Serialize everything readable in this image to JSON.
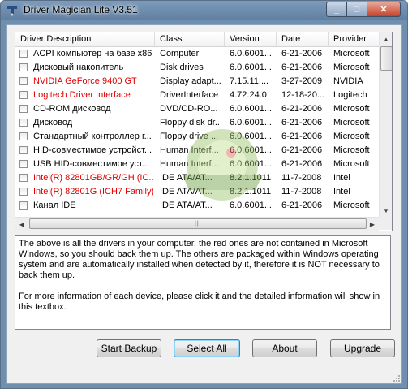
{
  "window": {
    "title": "Driver Magician Lite V3.51",
    "controls": {
      "minimize": "_",
      "maximize": "□",
      "close": "✕"
    }
  },
  "table": {
    "columns": [
      "Driver Description",
      "Class",
      "Version",
      "Date",
      "Provider"
    ],
    "rows": [
      {
        "description": "ACPI компьютер на базе x86",
        "class": "Computer",
        "version": "6.0.6001...",
        "date": "6-21-2006",
        "provider": "Microsoft",
        "red": false
      },
      {
        "description": "Дисковый накопитель",
        "class": "Disk drives",
        "version": "6.0.6001...",
        "date": "6-21-2006",
        "provider": "Microsoft",
        "red": false
      },
      {
        "description": "NVIDIA GeForce 9400 GT",
        "class": "Display adapt...",
        "version": "7.15.11....",
        "date": "3-27-2009",
        "provider": "NVIDIA",
        "red": true
      },
      {
        "description": "Logitech Driver Interface",
        "class": "DriverInterface",
        "version": "4.72.24.0",
        "date": "12-18-20...",
        "provider": "Logitech",
        "red": true
      },
      {
        "description": "CD-ROM дисковод",
        "class": "DVD/CD-RO...",
        "version": "6.0.6001...",
        "date": "6-21-2006",
        "provider": "Microsoft",
        "red": false
      },
      {
        "description": "Дисковод",
        "class": "Floppy disk dr...",
        "version": "6.0.6001...",
        "date": "6-21-2006",
        "provider": "Microsoft",
        "red": false
      },
      {
        "description": "Стандартный контроллер г...",
        "class": "Floppy drive ...",
        "version": "6.0.6001...",
        "date": "6-21-2006",
        "provider": "Microsoft",
        "red": false
      },
      {
        "description": "HID-совместимое устройст...",
        "class": "Human Interf...",
        "version": "6.0.6001...",
        "date": "6-21-2006",
        "provider": "Microsoft",
        "red": false
      },
      {
        "description": "USB HID-совместимое уст...",
        "class": "Human Interf...",
        "version": "6.0.6001...",
        "date": "6-21-2006",
        "provider": "Microsoft",
        "red": false
      },
      {
        "description": "Intel(R) 82801GB/GR/GH (IC...",
        "class": "IDE ATA/AT...",
        "version": "8.2.1.1011",
        "date": "11-7-2008",
        "provider": "Intel",
        "red": true
      },
      {
        "description": "Intel(R) 82801G (ICH7 Family)...",
        "class": "IDE ATA/AT...",
        "version": "8.2.1.1011",
        "date": "11-7-2008",
        "provider": "Intel",
        "red": true
      },
      {
        "description": "Канал IDE",
        "class": "IDE ATA/AT...",
        "version": "6.0.6001...",
        "date": "6-21-2006",
        "provider": "Microsoft",
        "red": false
      }
    ]
  },
  "info_text": {
    "paragraph1": "The above is all the drivers in your computer, the red ones are not contained in Microsoft Windows, so you should back them up. The others are packaged within Windows operating system and are automatically installed when detected by it, therefore it is NOT necessary to back them up.",
    "paragraph2": "For more information of each device, please click it and the detailed information will show in this textbox."
  },
  "buttons": {
    "start_backup": "Start Backup",
    "select_all": "Select All",
    "about": "About",
    "upgrade": "Upgrade"
  },
  "colors": {
    "red_driver": "#e00000",
    "titlebar": "#6e8fae",
    "close_button": "#c4412a"
  },
  "icons": {
    "app": "driver-magician-icon",
    "watermark": "watermark-logo"
  }
}
